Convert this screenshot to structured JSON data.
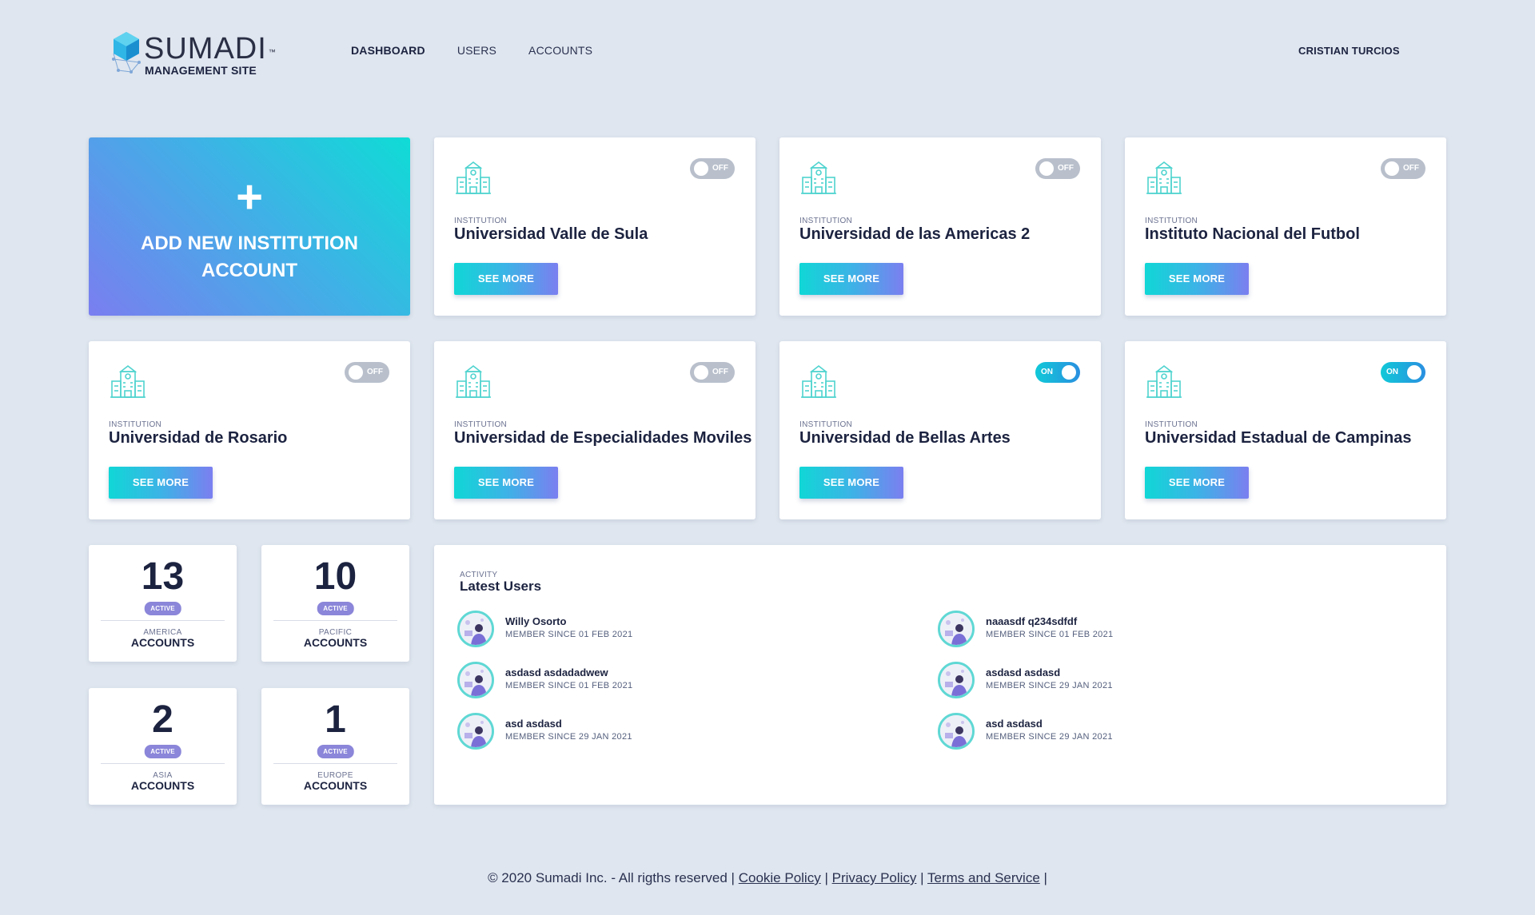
{
  "header": {
    "logo": {
      "title": "SUMADI",
      "trademark": "™",
      "subtitle": "MANAGEMENT SITE"
    },
    "nav": [
      {
        "label": "DASHBOARD",
        "active": true
      },
      {
        "label": "USERS",
        "active": false
      },
      {
        "label": "ACCOUNTS",
        "active": false
      }
    ],
    "user_name": "CRISTIAN TURCIOS"
  },
  "add_card": {
    "plus": "+",
    "label": "ADD NEW INSTITUTION ACCOUNT"
  },
  "institutions": [
    {
      "kicker": "INSTITUTION",
      "name": "Universidad Valle de Sula",
      "toggle": "OFF",
      "button": "SEE MORE"
    },
    {
      "kicker": "INSTITUTION",
      "name": "Universidad de las Americas 2",
      "toggle": "OFF",
      "button": "SEE MORE"
    },
    {
      "kicker": "INSTITUTION",
      "name": "Instituto Nacional del Futbol",
      "toggle": "OFF",
      "button": "SEE MORE"
    },
    {
      "kicker": "INSTITUTION",
      "name": "Universidad de Rosario",
      "toggle": "OFF",
      "button": "SEE MORE"
    },
    {
      "kicker": "INSTITUTION",
      "name": "Universidad de Especialidades Moviles",
      "toggle": "OFF",
      "button": "SEE MORE"
    },
    {
      "kicker": "INSTITUTION",
      "name": "Universidad de Bellas Artes",
      "toggle": "ON",
      "button": "SEE MORE"
    },
    {
      "kicker": "INSTITUTION",
      "name": "Universidad Estadual de Campinas",
      "toggle": "ON",
      "button": "SEE MORE"
    }
  ],
  "stats": [
    {
      "count": "13",
      "badge": "ACTIVE",
      "region": "AMERICA",
      "label": "ACCOUNTS"
    },
    {
      "count": "10",
      "badge": "ACTIVE",
      "region": "PACIFIC",
      "label": "ACCOUNTS"
    },
    {
      "count": "2",
      "badge": "ACTIVE",
      "region": "ASIA",
      "label": "ACCOUNTS"
    },
    {
      "count": "1",
      "badge": "ACTIVE",
      "region": "EUROPE",
      "label": "ACCOUNTS"
    }
  ],
  "activity": {
    "kicker": "ACTIVITY",
    "title": "Latest Users",
    "users": [
      {
        "name": "Willy Osorto",
        "since": "MEMBER SINCE 01 FEB 2021"
      },
      {
        "name": "naaasdf q234sdfdf",
        "since": "MEMBER SINCE 01 FEB 2021"
      },
      {
        "name": "asdasd asdadadwew",
        "since": "MEMBER SINCE 01 FEB 2021"
      },
      {
        "name": "asdasd asdasd",
        "since": "MEMBER SINCE 29 JAN 2021"
      },
      {
        "name": "asd asdasd",
        "since": "MEMBER SINCE 29 JAN 2021"
      },
      {
        "name": "asd asdasd",
        "since": "MEMBER SINCE 29 JAN 2021"
      }
    ]
  },
  "footer": {
    "copyright": "© 2020 Sumadi Inc. - All rigths reserved |",
    "links": [
      "Cookie Policy",
      "Privacy Policy",
      "Terms and Service"
    ],
    "separator": "|"
  },
  "colors": {
    "background": "#dfe6ef",
    "accent_teal": "#10d7d6",
    "accent_purple": "#7b7ff0",
    "text_dark": "#1c2340",
    "badge": "#8b86d9"
  }
}
